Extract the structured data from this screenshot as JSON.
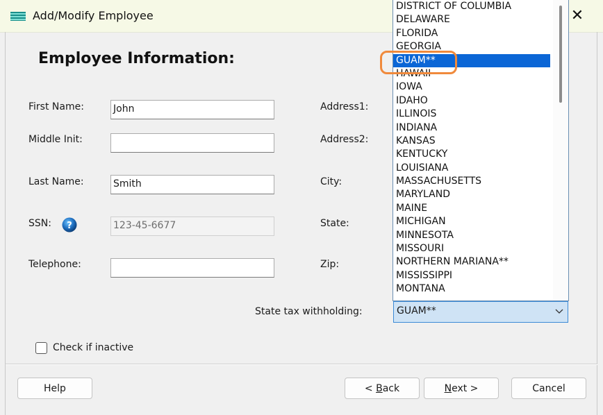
{
  "window": {
    "title": "Add/Modify Employee",
    "app_icon": "list-icon",
    "close_glyph": "✕"
  },
  "form": {
    "heading": "Employee Information:",
    "first_name": {
      "label": "First Name:",
      "value": "John"
    },
    "middle_init": {
      "label": "Middle Init:",
      "value": ""
    },
    "last_name": {
      "label": "Last Name:",
      "value": "Smith"
    },
    "ssn": {
      "label": "SSN:",
      "value": "123-45-6677",
      "help_icon": "question-icon"
    },
    "telephone": {
      "label": "Telephone:",
      "value": ""
    },
    "address1": {
      "label": "Address1:"
    },
    "address2": {
      "label": "Address2:"
    },
    "city": {
      "label": "City:"
    },
    "state": {
      "label": "State:"
    },
    "zip": {
      "label": "Zip:"
    },
    "state_tax": {
      "label": "State tax withholding:",
      "value": "GUAM**"
    },
    "inactive": {
      "label": "Check if inactive",
      "checked": false
    }
  },
  "dropdown": {
    "options": [
      "DISTRICT OF COLUMBIA",
      "DELAWARE",
      "FLORIDA",
      "GEORGIA",
      "GUAM**",
      "HAWAII",
      "IOWA",
      "IDAHO",
      "ILLINOIS",
      "INDIANA",
      "KANSAS",
      "KENTUCKY",
      "LOUISIANA",
      "MASSACHUSETTS",
      "MARYLAND",
      "MAINE",
      "MICHIGAN",
      "MINNESOTA",
      "MISSOURI",
      "NORTHERN MARIANA**",
      "MISSISSIPPI",
      "MONTANA"
    ],
    "selected": "GUAM**"
  },
  "buttons": {
    "help": "Help",
    "back_prefix": "< ",
    "back_accel": "B",
    "back_rest": "ack",
    "next_accel": "N",
    "next_rest": "ext >",
    "cancel": "Cancel"
  },
  "colors": {
    "titlebar": "#f6f9e6",
    "selection": "#0b66d6",
    "combo_focus": "#cfe3f5",
    "highlight_ring": "#f08a3c"
  }
}
